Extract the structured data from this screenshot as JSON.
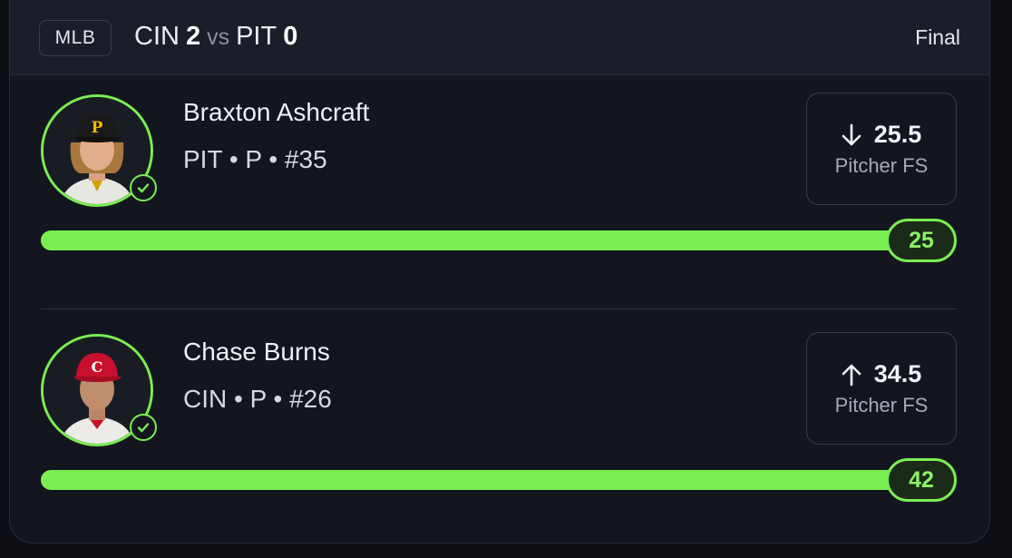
{
  "header": {
    "league": "MLB",
    "home_team": "CIN",
    "home_score": "2",
    "vs": "vs",
    "away_team": "PIT",
    "away_score": "0",
    "status": "Final"
  },
  "players": [
    {
      "name": "Braxton Ashcraft",
      "meta": "PIT • P • #35",
      "direction": "down",
      "line": "25.5",
      "stat": "Pitcher FS",
      "result": "25",
      "progress_fraction": 1.0,
      "cap": "pirates-cap",
      "cap_color": "#1a1a1a",
      "cap_logo_color": "#f5b700"
    },
    {
      "name": "Chase Burns",
      "meta": "CIN • P • #26",
      "direction": "up",
      "line": "34.5",
      "stat": "Pitcher FS",
      "result": "42",
      "progress_fraction": 1.0,
      "cap": "reds-cap",
      "cap_color": "#c8102e",
      "cap_logo_color": "#ffffff"
    }
  ],
  "colors": {
    "accent": "#79ee52",
    "background": "#14161f",
    "header": "#1b1e28"
  }
}
